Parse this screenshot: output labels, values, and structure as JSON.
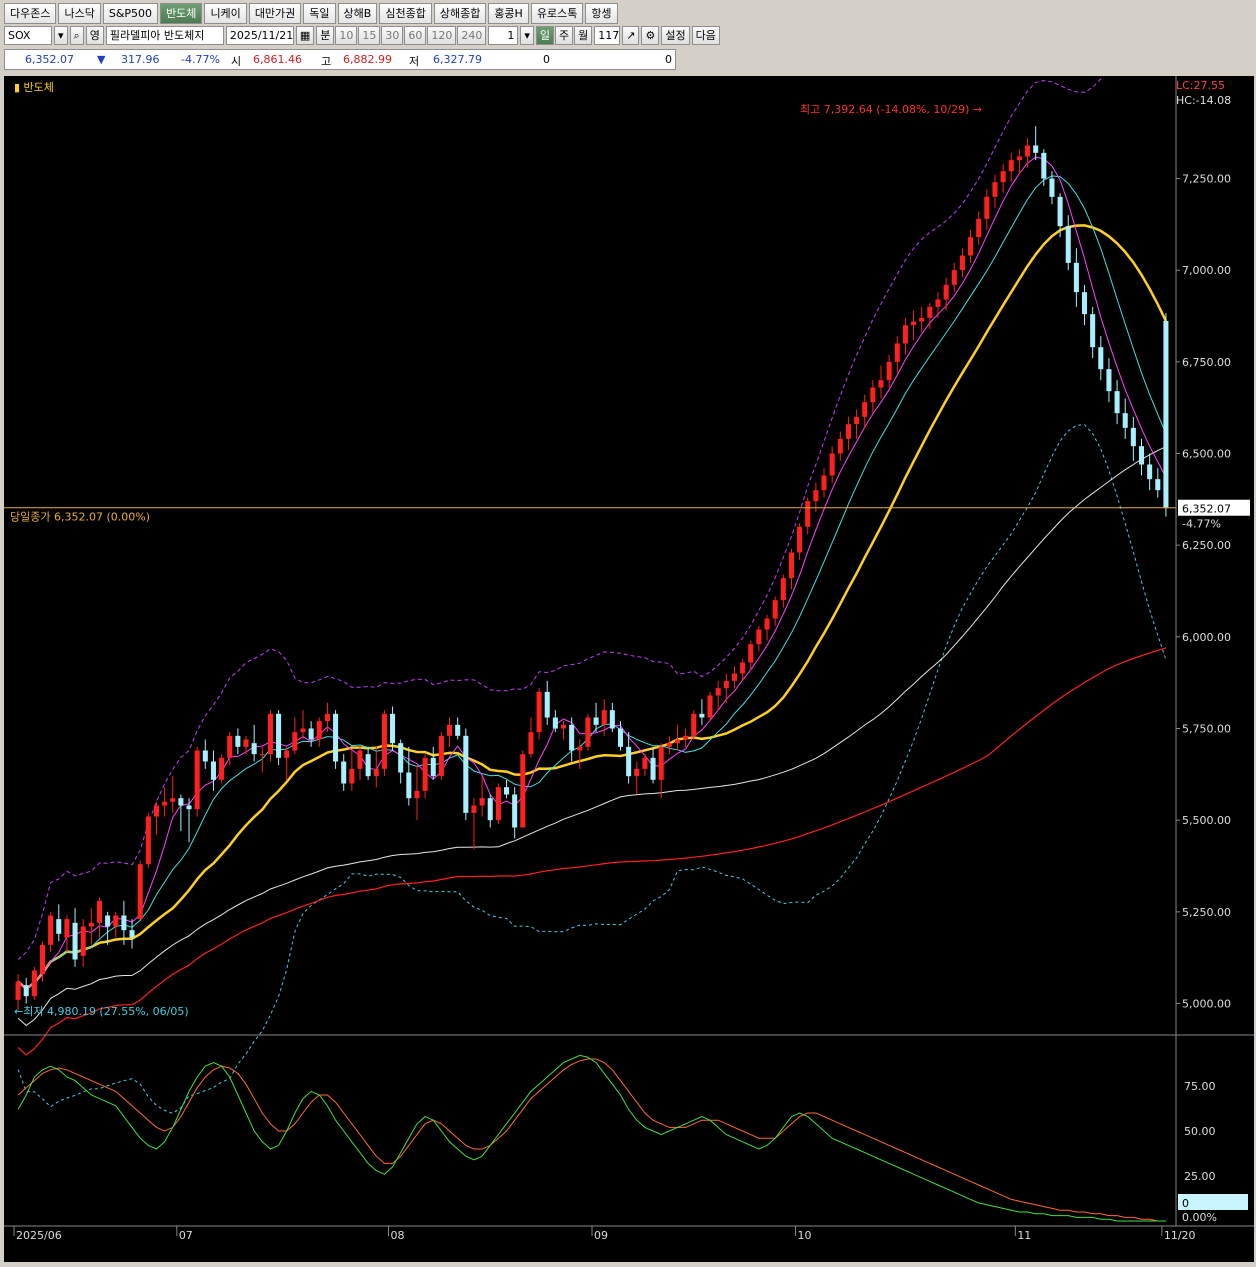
{
  "tabs": [
    "다우존스",
    "나스닥",
    "S&P500",
    "반도체",
    "니케이",
    "대만가권",
    "독일",
    "상해B",
    "심천종합",
    "상해종합",
    "홍콩H",
    "유로스톡",
    "항셍"
  ],
  "active_tab": "반도체",
  "toolbar": {
    "symbol": "SOX",
    "hint": "영",
    "name": "필라델피아 반도체지",
    "date": "2025/11/21",
    "intervals": [
      "분",
      "10",
      "15",
      "30",
      "60",
      "120",
      "240"
    ],
    "count": "1",
    "periods": [
      "일",
      "주",
      "월"
    ],
    "bars": "117",
    "settings_label": "설정",
    "next_label": "다음"
  },
  "quote": {
    "price": "6,352.07",
    "arrow": "▼",
    "change": "317.96",
    "pct": "-4.77%",
    "open_label": "시",
    "open": "6,861.46",
    "high_label": "고",
    "high": "6,882.99",
    "low_label": "저",
    "low": "6,327.79",
    "vol1": "0",
    "vol2": "0"
  },
  "colors": {
    "up": "#ff2020",
    "down": "#a8f0ff",
    "ma5": "#ff40ff",
    "ma10": "#40e0e0",
    "ma20": "#ffd020",
    "ma60": "#e8e8e8",
    "ma120": "#ff2020",
    "bband": "#c040ff",
    "lower": "#40d0e0"
  },
  "chart_data": {
    "type": "candlestick",
    "title": "반도체",
    "yticks": [
      "7,250.00",
      "7,000.00",
      "6,750.00",
      "6,500.00",
      "6,250.00",
      "6,000.00",
      "5,750.00",
      "5,500.00",
      "5,250.00",
      "5,000.00"
    ],
    "ytick_values": [
      7250,
      7000,
      6750,
      6500,
      6250,
      6000,
      5750,
      5500,
      5250,
      5000
    ],
    "ylim": [
      4925,
      7475
    ],
    "month_labels": [
      {
        "label": "2025/06",
        "i": 0
      },
      {
        "label": "07",
        "i": 20
      },
      {
        "label": "08",
        "i": 46
      },
      {
        "label": "09",
        "i": 71
      },
      {
        "label": "10",
        "i": 96
      },
      {
        "label": "11",
        "i": 123
      },
      {
        "label": "11/20",
        "i": 141
      }
    ],
    "lc": "LC:27.55",
    "hc": "HC:-14.08",
    "high_note": "최고 7,392.64 (-14.08%, 10/29) →",
    "low_note": "←최저 4,980.19 (27.55%, 06/05)",
    "close_line_label": "당일종가 6,352.07 (0.00%)",
    "last_price_tag": "6,352.07",
    "last_pct_tag": "-4.77%",
    "close_level": 6352.07,
    "candles": [
      [
        5010,
        5080,
        4980,
        5060
      ],
      [
        5050,
        5070,
        5000,
        5020
      ],
      [
        5020,
        5100,
        5010,
        5090
      ],
      [
        5080,
        5170,
        5060,
        5160
      ],
      [
        5160,
        5250,
        5140,
        5240
      ],
      [
        5230,
        5270,
        5170,
        5190
      ],
      [
        5180,
        5240,
        5140,
        5230
      ],
      [
        5220,
        5260,
        5100,
        5120
      ],
      [
        5130,
        5230,
        5100,
        5210
      ],
      [
        5210,
        5260,
        5160,
        5220
      ],
      [
        5220,
        5290,
        5180,
        5280
      ],
      [
        5240,
        5250,
        5160,
        5210
      ],
      [
        5210,
        5250,
        5180,
        5240
      ],
      [
        5240,
        5280,
        5160,
        5200
      ],
      [
        5200,
        5230,
        5150,
        5180
      ],
      [
        5230,
        5390,
        5230,
        5380
      ],
      [
        5380,
        5520,
        5370,
        5510
      ],
      [
        5510,
        5550,
        5460,
        5540
      ],
      [
        5540,
        5590,
        5510,
        5550
      ],
      [
        5550,
        5620,
        5520,
        5560
      ],
      [
        5560,
        5570,
        5470,
        5540
      ],
      [
        5540,
        5560,
        5440,
        5530
      ],
      [
        5530,
        5700,
        5510,
        5690
      ],
      [
        5690,
        5720,
        5640,
        5660
      ],
      [
        5660,
        5690,
        5580,
        5610
      ],
      [
        5610,
        5680,
        5600,
        5670
      ],
      [
        5670,
        5740,
        5650,
        5730
      ],
      [
        5730,
        5750,
        5680,
        5700
      ],
      [
        5700,
        5730,
        5680,
        5720
      ],
      [
        5710,
        5760,
        5660,
        5680
      ],
      [
        5680,
        5700,
        5630,
        5680
      ],
      [
        5680,
        5800,
        5660,
        5790
      ],
      [
        5790,
        5800,
        5650,
        5670
      ],
      [
        5670,
        5700,
        5610,
        5690
      ],
      [
        5690,
        5780,
        5680,
        5740
      ],
      [
        5740,
        5800,
        5720,
        5750
      ],
      [
        5750,
        5770,
        5700,
        5720
      ],
      [
        5720,
        5780,
        5700,
        5770
      ],
      [
        5770,
        5820,
        5740,
        5790
      ],
      [
        5790,
        5800,
        5640,
        5660
      ],
      [
        5660,
        5680,
        5580,
        5600
      ],
      [
        5600,
        5690,
        5580,
        5640
      ],
      [
        5640,
        5700,
        5610,
        5690
      ],
      [
        5680,
        5700,
        5610,
        5620
      ],
      [
        5620,
        5700,
        5590,
        5640
      ],
      [
        5640,
        5800,
        5620,
        5790
      ],
      [
        5790,
        5810,
        5690,
        5710
      ],
      [
        5710,
        5720,
        5600,
        5630
      ],
      [
        5630,
        5700,
        5540,
        5560
      ],
      [
        5560,
        5650,
        5500,
        5580
      ],
      [
        5580,
        5680,
        5560,
        5670
      ],
      [
        5670,
        5700,
        5610,
        5620
      ],
      [
        5620,
        5740,
        5610,
        5730
      ],
      [
        5730,
        5780,
        5700,
        5760
      ],
      [
        5760,
        5780,
        5720,
        5730
      ],
      [
        5730,
        5750,
        5500,
        5520
      ],
      [
        5520,
        5560,
        5420,
        5540
      ],
      [
        5540,
        5620,
        5510,
        5560
      ],
      [
        5560,
        5570,
        5480,
        5500
      ],
      [
        5500,
        5600,
        5490,
        5590
      ],
      [
        5590,
        5610,
        5560,
        5570
      ],
      [
        5570,
        5590,
        5450,
        5480
      ],
      [
        5480,
        5690,
        5480,
        5680
      ],
      [
        5680,
        5780,
        5670,
        5740
      ],
      [
        5740,
        5860,
        5720,
        5850
      ],
      [
        5850,
        5880,
        5760,
        5780
      ],
      [
        5780,
        5800,
        5740,
        5750
      ],
      [
        5750,
        5770,
        5720,
        5760
      ],
      [
        5760,
        5780,
        5660,
        5690
      ],
      [
        5690,
        5720,
        5640,
        5700
      ],
      [
        5700,
        5790,
        5690,
        5780
      ],
      [
        5780,
        5820,
        5740,
        5760
      ],
      [
        5760,
        5830,
        5730,
        5800
      ],
      [
        5800,
        5820,
        5740,
        5750
      ],
      [
        5750,
        5770,
        5690,
        5700
      ],
      [
        5700,
        5740,
        5600,
        5620
      ],
      [
        5620,
        5660,
        5570,
        5640
      ],
      [
        5640,
        5680,
        5620,
        5670
      ],
      [
        5670,
        5700,
        5600,
        5610
      ],
      [
        5610,
        5710,
        5560,
        5700
      ],
      [
        5700,
        5730,
        5680,
        5710
      ],
      [
        5710,
        5760,
        5690,
        5720
      ],
      [
        5720,
        5750,
        5700,
        5730
      ],
      [
        5730,
        5800,
        5720,
        5790
      ],
      [
        5790,
        5830,
        5760,
        5780
      ],
      [
        5780,
        5850,
        5770,
        5840
      ],
      [
        5840,
        5880,
        5800,
        5860
      ],
      [
        5860,
        5900,
        5820,
        5880
      ],
      [
        5880,
        5920,
        5860,
        5900
      ],
      [
        5900,
        5940,
        5880,
        5930
      ],
      [
        5930,
        5990,
        5910,
        5980
      ],
      [
        5980,
        6030,
        5960,
        6020
      ],
      [
        6020,
        6060,
        5990,
        6050
      ],
      [
        6050,
        6110,
        6030,
        6100
      ],
      [
        6100,
        6170,
        6080,
        6160
      ],
      [
        6160,
        6240,
        6130,
        6230
      ],
      [
        6230,
        6310,
        6210,
        6300
      ],
      [
        6300,
        6380,
        6280,
        6370
      ],
      [
        6370,
        6420,
        6340,
        6400
      ],
      [
        6400,
        6460,
        6380,
        6440
      ],
      [
        6440,
        6520,
        6420,
        6500
      ],
      [
        6500,
        6560,
        6480,
        6540
      ],
      [
        6540,
        6600,
        6510,
        6580
      ],
      [
        6580,
        6620,
        6540,
        6600
      ],
      [
        6600,
        6660,
        6570,
        6640
      ],
      [
        6640,
        6700,
        6610,
        6680
      ],
      [
        6680,
        6740,
        6650,
        6700
      ],
      [
        6700,
        6770,
        6680,
        6750
      ],
      [
        6750,
        6820,
        6720,
        6800
      ],
      [
        6800,
        6870,
        6770,
        6850
      ],
      [
        6850,
        6890,
        6810,
        6860
      ],
      [
        6860,
        6900,
        6830,
        6870
      ],
      [
        6870,
        6910,
        6840,
        6900
      ],
      [
        6900,
        6940,
        6870,
        6920
      ],
      [
        6920,
        6980,
        6890,
        6960
      ],
      [
        6960,
        7020,
        6940,
        7000
      ],
      [
        7000,
        7060,
        6980,
        7040
      ],
      [
        7040,
        7110,
        7020,
        7090
      ],
      [
        7090,
        7160,
        7070,
        7140
      ],
      [
        7140,
        7220,
        7110,
        7200
      ],
      [
        7200,
        7260,
        7170,
        7240
      ],
      [
        7240,
        7290,
        7210,
        7270
      ],
      [
        7270,
        7320,
        7240,
        7300
      ],
      [
        7300,
        7330,
        7260,
        7310
      ],
      [
        7310,
        7360,
        7280,
        7340
      ],
      [
        7340,
        7392.64,
        7300,
        7320
      ],
      [
        7320,
        7330,
        7230,
        7250
      ],
      [
        7250,
        7270,
        7180,
        7200
      ],
      [
        7200,
        7210,
        7090,
        7120
      ],
      [
        7120,
        7150,
        7000,
        7020
      ],
      [
        7020,
        7060,
        6900,
        6940
      ],
      [
        6940,
        6960,
        6850,
        6880
      ],
      [
        6880,
        6900,
        6760,
        6790
      ],
      [
        6790,
        6820,
        6700,
        6730
      ],
      [
        6730,
        6760,
        6640,
        6670
      ],
      [
        6670,
        6700,
        6580,
        6610
      ],
      [
        6610,
        6650,
        6540,
        6570
      ],
      [
        6570,
        6600,
        6480,
        6520
      ],
      [
        6520,
        6540,
        6440,
        6470
      ],
      [
        6470,
        6500,
        6400,
        6430
      ],
      [
        6430,
        6460,
        6380,
        6400
      ],
      [
        6861.46,
        6882.99,
        6327.79,
        6352.07
      ]
    ],
    "stoch_yticks": [
      "75.00",
      "50.00",
      "25.00"
    ],
    "stoch_ytick_values": [
      75,
      50,
      25
    ],
    "stoch_ylim": [
      0,
      100
    ],
    "stoch_tags": [
      "0",
      "0.00%"
    ],
    "stoch_k": [
      62,
      70,
      80,
      84,
      86,
      84,
      80,
      78,
      74,
      70,
      68,
      66,
      64,
      58,
      52,
      46,
      42,
      40,
      44,
      52,
      62,
      72,
      80,
      86,
      88,
      86,
      80,
      70,
      60,
      50,
      44,
      40,
      42,
      50,
      60,
      68,
      72,
      70,
      64,
      56,
      50,
      44,
      38,
      32,
      28,
      26,
      30,
      38,
      46,
      54,
      58,
      56,
      50,
      44,
      40,
      36,
      34,
      36,
      42,
      48,
      54,
      60,
      66,
      72,
      76,
      80,
      84,
      88,
      90,
      92,
      91,
      88,
      82,
      76,
      70,
      62,
      56,
      52,
      50,
      48,
      50,
      52,
      54,
      56,
      58,
      56,
      52,
      48,
      46,
      44,
      42,
      40,
      42,
      46,
      52,
      58,
      60,
      58,
      54,
      50,
      46,
      44,
      42,
      40,
      38,
      36,
      34,
      32,
      30,
      28,
      26,
      24,
      22,
      20,
      18,
      16,
      14,
      12,
      10,
      9,
      8,
      7,
      6,
      5,
      5,
      4,
      4,
      3,
      3,
      3,
      2,
      2,
      2,
      1,
      1,
      0,
      0,
      0,
      0,
      0,
      0,
      0
    ],
    "stoch_d": [
      70,
      74,
      78,
      82,
      84,
      85,
      84,
      82,
      80,
      78,
      76,
      74,
      72,
      68,
      64,
      60,
      56,
      52,
      50,
      52,
      58,
      66,
      74,
      80,
      84,
      86,
      85,
      82,
      76,
      68,
      60,
      54,
      50,
      50,
      54,
      60,
      66,
      70,
      70,
      66,
      60,
      54,
      48,
      42,
      36,
      32,
      32,
      36,
      42,
      48,
      54,
      56,
      54,
      50,
      46,
      42,
      40,
      40,
      42,
      46,
      50,
      56,
      62,
      68,
      72,
      76,
      80,
      84,
      87,
      89,
      90,
      90,
      88,
      84,
      78,
      72,
      66,
      60,
      56,
      54,
      52,
      52,
      52,
      54,
      56,
      56,
      56,
      54,
      52,
      50,
      48,
      46,
      46,
      46,
      50,
      54,
      58,
      60,
      60,
      58,
      56,
      54,
      52,
      50,
      48,
      46,
      44,
      42,
      40,
      38,
      36,
      34,
      32,
      30,
      28,
      26,
      24,
      22,
      20,
      18,
      16,
      14,
      12,
      11,
      10,
      9,
      8,
      7,
      6,
      6,
      5,
      5,
      4,
      4,
      3,
      3,
      2,
      2,
      1,
      1,
      0,
      0
    ]
  }
}
